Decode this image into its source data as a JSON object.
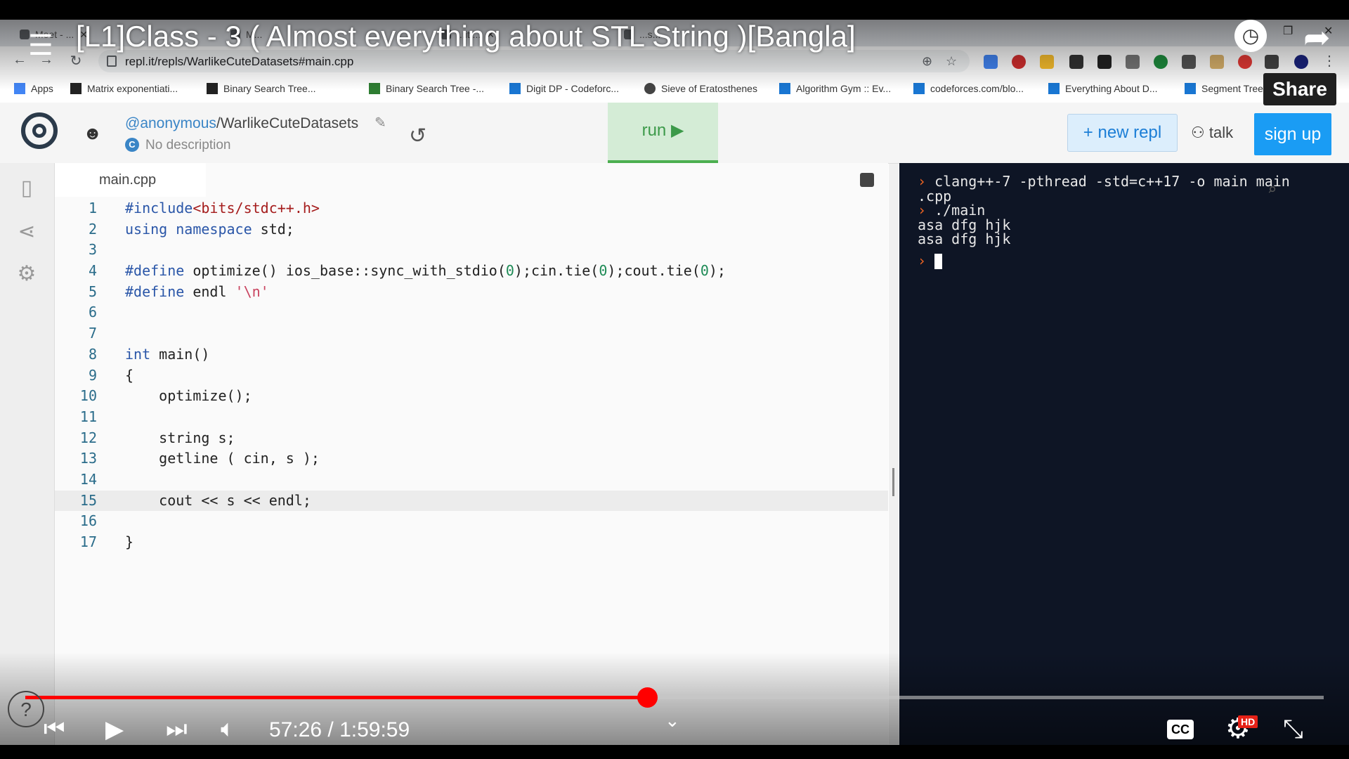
{
  "video": {
    "title": "[L1]Class - 3 ( Almost everything about STL String )[Bangla]",
    "share_label": "Share",
    "time": "57:26 / 1:59:59",
    "progress_fraction": 0.4787,
    "help_label": "?",
    "hd_badge": "HD",
    "cc_label": "CC"
  },
  "browser": {
    "tabs": [
      "Meet - ...",
      "M...",
      "...it ...",
      "...s..."
    ],
    "url": "repl.it/repls/WarlikeCuteDatasets#main.cpp",
    "bookmarks": [
      "Apps",
      "Matrix exponentiati...",
      "Binary Search Tree...",
      "Binary Search Tree -...",
      "Digit DP - Codeforc...",
      "Sieve of Eratosthenes",
      "Algorithm Gym :: Ev...",
      "codeforces.com/blo...",
      "Everything About D...",
      "Segment Tree"
    ]
  },
  "replit": {
    "owner": "@anonymous",
    "repl_name": "/WarlikeCuteDatasets",
    "description": "No description",
    "run_label": "run ▶",
    "new_repl_label": "+ new repl",
    "talk_label": "talk",
    "signup_label": "sign up",
    "file_tab": "main.cpp",
    "active_line": 15
  },
  "code_lines": [
    {
      "n": "1",
      "text": "#include<bits/stdc++.h>"
    },
    {
      "n": "2",
      "text": "using namespace std;"
    },
    {
      "n": "3",
      "text": ""
    },
    {
      "n": "4",
      "text": "#define optimize() ios_base::sync_with_stdio(0);cin.tie(0);cout.tie(0);"
    },
    {
      "n": "5",
      "text": "#define endl '\\n'"
    },
    {
      "n": "6",
      "text": ""
    },
    {
      "n": "7",
      "text": ""
    },
    {
      "n": "8",
      "text": "int main()"
    },
    {
      "n": "9",
      "text": "{"
    },
    {
      "n": "10",
      "text": "    optimize();"
    },
    {
      "n": "11",
      "text": ""
    },
    {
      "n": "12",
      "text": "    string s;"
    },
    {
      "n": "13",
      "text": "    getline ( cin, s );"
    },
    {
      "n": "14",
      "text": ""
    },
    {
      "n": "15",
      "text": "    cout << s << endl;"
    },
    {
      "n": "16",
      "text": ""
    },
    {
      "n": "17",
      "text": "}"
    }
  ],
  "terminal": {
    "lines": [
      {
        "prompt": true,
        "text": "clang++-7 -pthread -std=c++17 -o main main"
      },
      {
        "prompt": false,
        "text": ".cpp"
      },
      {
        "prompt": true,
        "text": "./main"
      },
      {
        "prompt": false,
        "text": "asa dfg hjk"
      },
      {
        "prompt": false,
        "text": "asa dfg hjk"
      }
    ],
    "prompt_symbol": "›"
  }
}
